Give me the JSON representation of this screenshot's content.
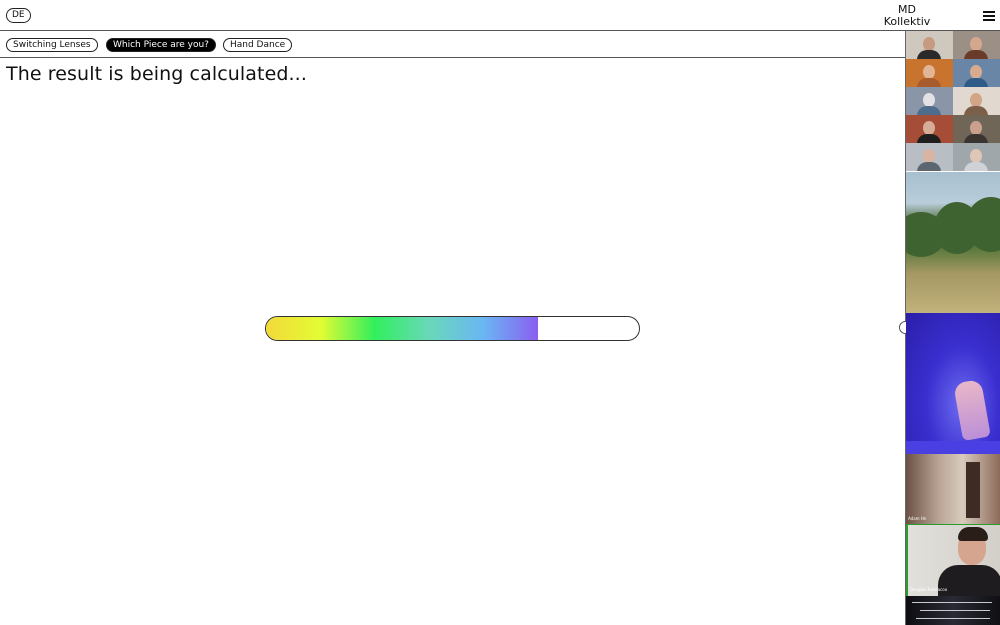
{
  "header": {
    "language_button": "DE",
    "brand_line1": "MD",
    "brand_line2": "Kollektiv",
    "menu_icon": "hamburger-icon"
  },
  "tabs": [
    {
      "label": "Switching Lenses",
      "active": false
    },
    {
      "label": "Which Piece are you?",
      "active": true
    },
    {
      "label": "Hand Dance",
      "active": false
    }
  ],
  "main": {
    "heading": "The result is being calculated..."
  },
  "progress": {
    "fraction": 0.73,
    "gradient_colors": [
      "#f3d93a",
      "#e3fc34",
      "#31ef5c",
      "#69d8b9",
      "#6ab6f4",
      "#8a5ef0"
    ]
  },
  "sidebar": {
    "video_labels": {
      "room": "Adam Hn",
      "person": "Douglas Kahnacoo"
    }
  }
}
